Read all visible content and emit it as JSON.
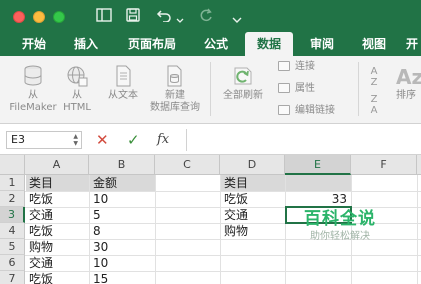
{
  "colors": {
    "brand": "#217346",
    "accent_text": "#217346",
    "watermark": "#2bb46a"
  },
  "titlebar": {
    "icons": [
      "sidebar-toggle-icon",
      "save-icon",
      "undo-icon",
      "undo-dropdown-icon",
      "redo-icon",
      "customize-dropdown-icon"
    ]
  },
  "tabs": [
    {
      "label": "开始",
      "active": false
    },
    {
      "label": "插入",
      "active": false
    },
    {
      "label": "页面布局",
      "active": false
    },
    {
      "label": "公式",
      "active": false
    },
    {
      "label": "数据",
      "active": true
    },
    {
      "label": "审阅",
      "active": false
    },
    {
      "label": "视图",
      "active": false
    },
    {
      "label": "开",
      "active": false
    }
  ],
  "ribbon": {
    "from_filemaker": {
      "line1": "从",
      "line2": "FileMaker"
    },
    "from_html": {
      "line1": "从",
      "line2": "HTML"
    },
    "from_text": "从文本",
    "new_query": {
      "line1": "新建",
      "line2": "数据库查询"
    },
    "refresh_all": "全部刷新",
    "connections": "连接",
    "properties": "属性",
    "edit_links": "编辑链接",
    "sort": "排序",
    "sort_az_letters": "Az"
  },
  "formula_bar": {
    "name_box": "E3",
    "cancel_symbol": "✕",
    "enter_symbol": "✓",
    "function_symbol": "fx",
    "formula": ""
  },
  "grid": {
    "columns": [
      "A",
      "B",
      "C",
      "D",
      "E",
      "F"
    ],
    "rows": [
      "1",
      "2",
      "3",
      "4",
      "5",
      "6",
      "7"
    ],
    "selected_cell": "E3",
    "cells": {
      "A1": "类目",
      "B1": "金额",
      "A2": "吃饭",
      "B2": "10",
      "A3": "交通",
      "B3": "5",
      "A4": "吃饭",
      "B4": "8",
      "A5": "购物",
      "B5": "30",
      "A6": "交通",
      "B6": "10",
      "A7": "吃饭",
      "B7": "15",
      "D1": "类目",
      "D2": "吃饭",
      "E2": "33",
      "D3": "交通",
      "D4": "购物"
    }
  },
  "watermark": {
    "title": "百科全说",
    "subtitle": "助你轻松解决"
  }
}
